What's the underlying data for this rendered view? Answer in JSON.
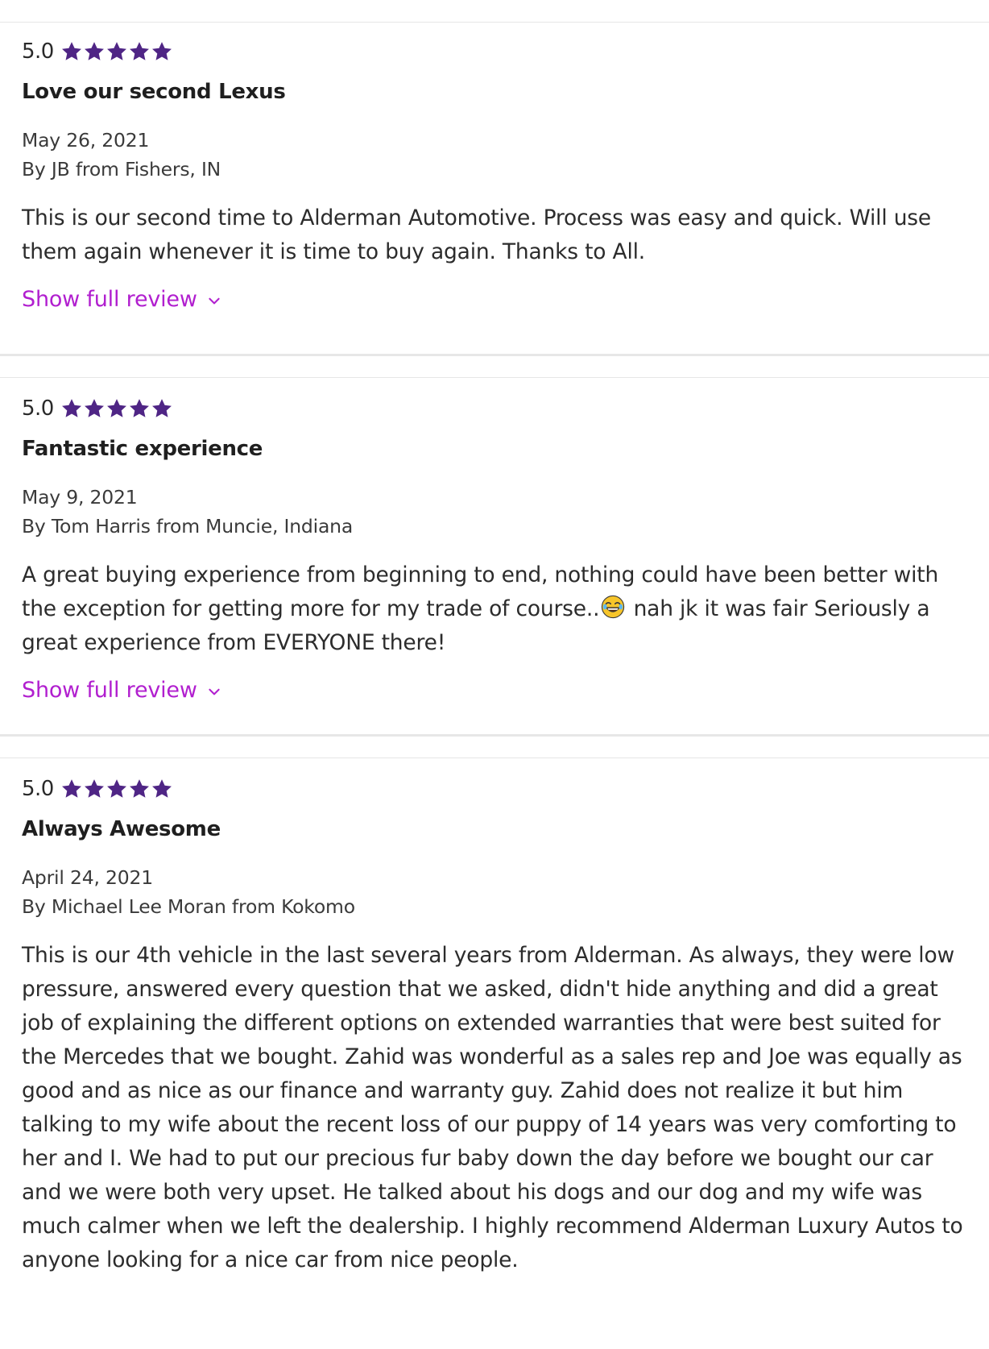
{
  "colors": {
    "star": "#4f2585",
    "link": "#b11fcf",
    "text": "#2a2a2a",
    "divider": "#e7e7e7"
  },
  "reviews": [
    {
      "rating": "5.0",
      "stars": 5,
      "title": "Love our second Lexus",
      "date": "May 26, 2021",
      "author": "By JB from Fishers, IN",
      "body": "This is our second time to Alderman Automotive. Process was easy and quick. Will use them again whenever it is time to buy again. Thanks to All.",
      "link": "Show full review"
    },
    {
      "rating": "5.0",
      "stars": 5,
      "title": "Fantastic experience",
      "date": "May 9, 2021",
      "author": "By Tom Harris from Muncie, Indiana",
      "body_before_emoji": "A great buying experience from beginning to end, nothing could have been better with the exception for getting more for my trade of course..",
      "body_emoji": "face-with-tears-of-joy-icon",
      "body_after_emoji": " nah jk it was fair Seriously a great experience from EVERYONE there!",
      "link": "Show full review"
    },
    {
      "rating": "5.0",
      "stars": 5,
      "title": "Always Awesome",
      "date": "April 24, 2021",
      "author": "By Michael Lee Moran from Kokomo",
      "body": "This is our 4th vehicle in the last several years from Alderman. As always, they were low pressure, answered every question that we asked, didn't hide anything and did a great job of explaining the different options on extended warranties that were best suited for the Mercedes that we bought. Zahid was wonderful as a sales rep and Joe was equally as good and as nice as our finance and warranty guy. Zahid does not realize it but him talking to my wife about the recent loss of our puppy of 14 years was very comforting to her and I. We had to put our precious fur baby down the day before we bought our car and we were both very upset. He talked about his dogs and our dog and my wife was much calmer when we left the dealership. I highly recommend Alderman Luxury Autos to anyone looking for a nice car from nice people."
    }
  ]
}
